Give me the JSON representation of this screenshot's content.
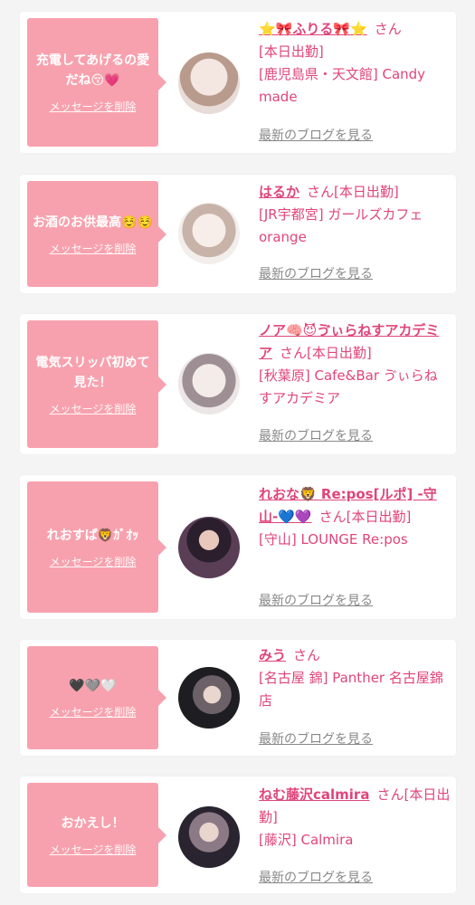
{
  "cards": [
    {
      "message": "充電してあげるの愛だね😚💗",
      "delete_label": "メッセージを削除",
      "name": "⭐🎀ふりる🎀⭐",
      "san": "さん",
      "status": "[本日出勤]",
      "shop": "[鹿児島県・天文館] Candy made",
      "blog_label": "最新のブログを見る",
      "avatar_colors": [
        "#e8dcd8",
        "#b99b8d"
      ]
    },
    {
      "message": "お酒のお供最高☺️☺️",
      "delete_label": "メッセージを削除",
      "name": "はるか",
      "san": "さん",
      "status": "[本日出勤]",
      "shop": "[JR宇都宮] ガールズカフェ orange",
      "blog_label": "最新のブログを見る",
      "avatar_colors": [
        "#f2eeec",
        "#c8b3a8"
      ]
    },
    {
      "message": "電気スリッパ初めて見た！",
      "delete_label": "メッセージを削除",
      "name": "ノア🧠😈ゔぃらねすアカデミア",
      "san": "さん",
      "status": "[本日出勤]",
      "shop": "[秋葉原] Cafe&Bar ゔぃらねすアカデミア",
      "blog_label": "最新のブログを見る",
      "avatar_colors": [
        "#ece6e6",
        "#9e8f95"
      ]
    },
    {
      "message": "れおすぱ🦁ｶﾞｵｯ",
      "delete_label": "メッセージを削除",
      "name": "れおな🦁 Re:pos[ルポ] -守山-💙💜",
      "san": "さん",
      "status": "[本日出勤]",
      "shop": "[守山] LOUNGE Re:pos",
      "blog_label": "最新のブログを見る",
      "avatar_colors": [
        "#5a3e56",
        "#2b1f2d"
      ]
    },
    {
      "message": "🖤🩶🤍",
      "delete_label": "メッセージを削除",
      "name": "みう",
      "san": "さん",
      "status": "",
      "shop": "[名古屋 錦] Panther 名古屋錦店",
      "blog_label": "最新のブログを見る",
      "avatar_colors": [
        "#1e1e22",
        "#6b6166"
      ]
    },
    {
      "message": "おかえし！",
      "delete_label": "メッセージを削除",
      "name": "ねむ藤沢calmira",
      "san": "さん",
      "status": "[本日出勤]",
      "shop": "[藤沢] Calmira",
      "blog_label": "最新のブログを見る",
      "avatar_colors": [
        "#2a2430",
        "#8b7a86"
      ]
    }
  ]
}
